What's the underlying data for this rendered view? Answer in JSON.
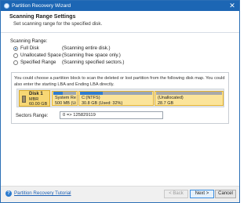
{
  "window": {
    "title": "Partition Recovery Wizard",
    "close_glyph": "✕"
  },
  "header": {
    "title": "Scanning Range Settings",
    "subtitle": "Set scanning range for the specified disk."
  },
  "scanning_range": {
    "group_label": "Scanning Range:",
    "options": [
      {
        "label": "Full Disk",
        "desc": "(Scanning entire disk.)",
        "selected": true
      },
      {
        "label": "Unallocated Space",
        "desc": "(Scanning free space only.)",
        "selected": false
      },
      {
        "label": "Specified Range",
        "desc": "(Scanning specified sectors.)",
        "selected": false
      }
    ]
  },
  "panel": {
    "description": "You could choose a partition block to scan the deleted or lost partition from the following disk map. You could also enter the starting LBA and Ending LBA directly.",
    "disk": {
      "name": "Disk 1",
      "type": "MBR",
      "size": "60.00 GB"
    },
    "partitions": [
      {
        "name": "System Rese",
        "info": "500 MB (Use",
        "used_fraction": 0.4
      },
      {
        "name": "C:(NTFS)",
        "info": "30.8 GB (Used: 32%)",
        "used_fraction": 0.32
      },
      {
        "name": "(Unallocated)",
        "info": "28.7 GB",
        "used_fraction": 0
      }
    ],
    "sectors_label": "Sectors Range:",
    "sectors_value": "0 => 125829119"
  },
  "footer": {
    "help_glyph": "?",
    "tutorial_link": "Partition Recovery Tutorial",
    "back_label": "< Back",
    "next_label": "Next >",
    "cancel_label": "Cancel"
  },
  "colors": {
    "title_bar": "#1c66b4",
    "accent_blue": "#2f7bd1",
    "selected_yellow": "#fbe49a"
  }
}
